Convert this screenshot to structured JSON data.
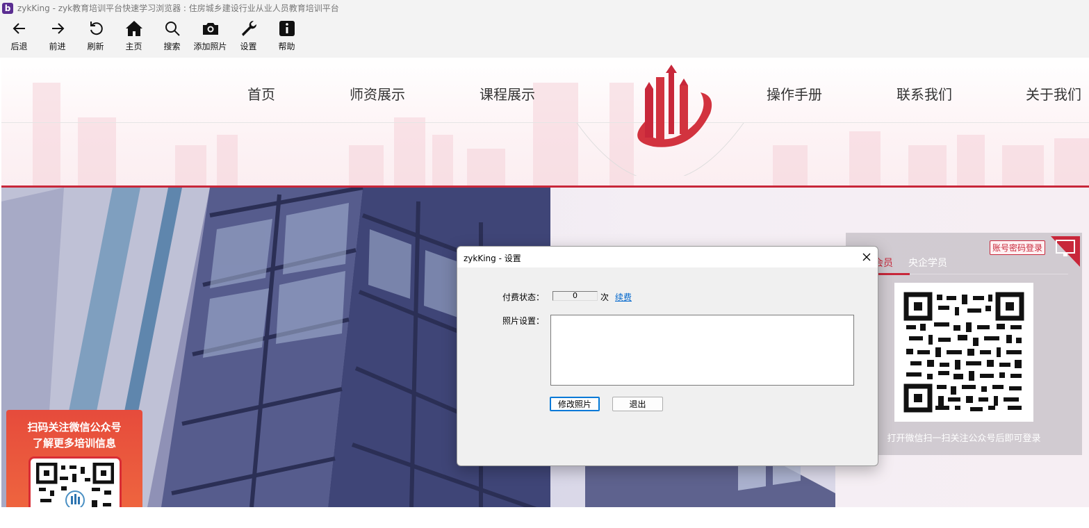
{
  "window": {
    "title": "zykKing - zyk教育培训平台快速学习浏览器 : 住房城乡建设行业从业人员教育培训平台",
    "logo_letter": "b"
  },
  "toolbar": {
    "back": "后退",
    "forward": "前进",
    "refresh": "刷新",
    "home": "主页",
    "search": "搜索",
    "add_photo": "添加照片",
    "settings": "设置",
    "help": "帮助"
  },
  "site": {
    "nav": [
      "首页",
      "师资展示",
      "课程展示",
      "操作手册",
      "联系我们",
      "关于我们"
    ],
    "accent_color": "#c8273a"
  },
  "login": {
    "tab_active": "会员",
    "tab_other": "央企学员",
    "password_login": "账号密码登录",
    "hint": "打开微信扫一扫关注公众号后即可登录"
  },
  "wechat": {
    "line1": "扫码关注微信公众号",
    "line2": "了解更多培训信息"
  },
  "dialog": {
    "title": "zykKing - 设置",
    "payment_label": "付费状态：",
    "count_value": "0",
    "count_unit": "次",
    "renew_link": "续费",
    "photo_label": "照片设置：",
    "change_photo_button": "修改照片",
    "exit_button": "退出"
  }
}
